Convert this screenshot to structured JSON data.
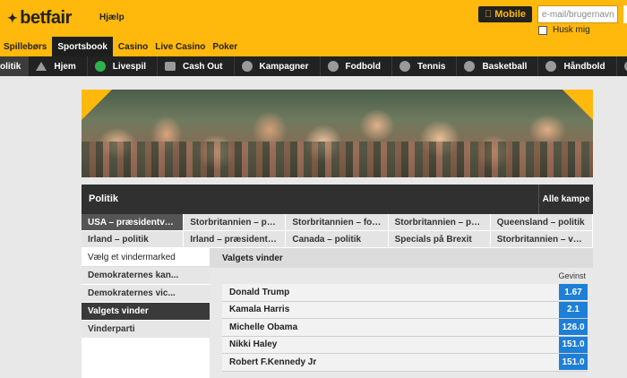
{
  "header": {
    "brand": "betfair",
    "help_label": "Hjælp",
    "mobile_label": "Mobile",
    "email_placeholder": "e-mail/brugernavn",
    "remember_label": "Husk mig",
    "products": [
      "Spillebørs",
      "Sportsbook",
      "Casino",
      "Live Casino",
      "Poker"
    ],
    "active_product": "Sportsbook"
  },
  "sport_nav": {
    "items": [
      {
        "label": "olitik",
        "icon": "none"
      },
      {
        "label": "Hjem",
        "icon": "home-icon"
      },
      {
        "label": "Livespil",
        "icon": "live-icon"
      },
      {
        "label": "Cash Out",
        "icon": "cashout-icon"
      },
      {
        "label": "Kampagner",
        "icon": "promotions-icon"
      },
      {
        "label": "Fodbold",
        "icon": "football-icon"
      },
      {
        "label": "Tennis",
        "icon": "tennis-icon"
      },
      {
        "label": "Basketball",
        "icon": "basketball-icon"
      },
      {
        "label": "Håndbold",
        "icon": "handball-icon"
      }
    ]
  },
  "section": {
    "title": "Politik",
    "all_matches": "Alle kampe",
    "subnav": [
      "USA – præsidentval...",
      "Storbritannien – part...",
      "Storbritannien – folk...",
      "Storbritannien – politik",
      "Queensland – politik",
      "Irland – politik",
      "Irland – præsidentvalg",
      "Canada – politik",
      "Specials på Brexit",
      "Storbritannien – valg..."
    ]
  },
  "left": {
    "heading": "Vælg et vindermarked",
    "items": [
      "Demokraternes kan...",
      "Demokraternes vic...",
      "Valgets vinder",
      "Vinderparti"
    ],
    "active": "Valgets vinder"
  },
  "market": {
    "title": "Valgets vinder",
    "column_label": "Gevinst",
    "runners": [
      {
        "name": "Donald Trump",
        "odds": "1.67"
      },
      {
        "name": "Kamala Harris",
        "odds": "2.1"
      },
      {
        "name": "Michelle Obama",
        "odds": "126.0"
      },
      {
        "name": "Nikki Haley",
        "odds": "151.0"
      },
      {
        "name": "Robert F.Kennedy Jr",
        "odds": "151.0"
      }
    ]
  },
  "colors": {
    "brand": "#ffb80c",
    "odds": "#1d7fd6",
    "nav": "#222222"
  }
}
